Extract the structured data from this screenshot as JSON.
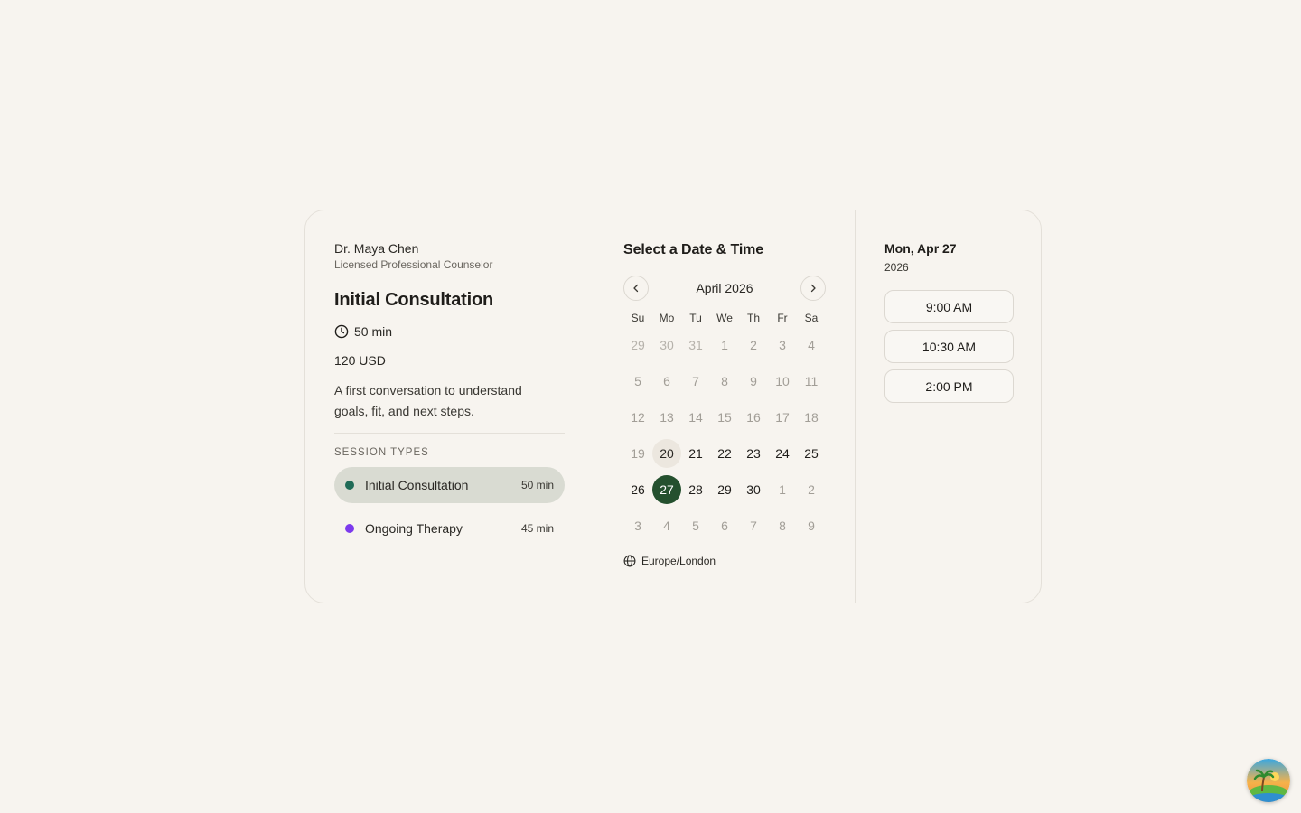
{
  "host": {
    "name": "Dr. Maya Chen",
    "title": "Licensed Professional Counselor"
  },
  "event": {
    "title": "Initial Consultation",
    "duration": "50 min",
    "price": "120 USD",
    "description": "A first conversation to understand goals, fit, and next steps."
  },
  "session_types": {
    "label": "SESSION TYPES",
    "items": [
      {
        "label": "Initial Consultation",
        "duration": "50 min",
        "color": "#1f6b57",
        "active": true
      },
      {
        "label": "Ongoing Therapy",
        "duration": "45 min",
        "color": "#7c3aed",
        "active": false
      }
    ]
  },
  "calendar": {
    "heading": "Select a Date & Time",
    "month_label": "April 2026",
    "weekdays": [
      "Su",
      "Mo",
      "Tu",
      "We",
      "Th",
      "Fr",
      "Sa"
    ],
    "days": [
      {
        "d": "29",
        "s": "muted"
      },
      {
        "d": "30",
        "s": "muted"
      },
      {
        "d": "31",
        "s": "muted"
      },
      {
        "d": "1",
        "s": "unavail"
      },
      {
        "d": "2",
        "s": "unavail"
      },
      {
        "d": "3",
        "s": "unavail"
      },
      {
        "d": "4",
        "s": "unavail"
      },
      {
        "d": "5",
        "s": "unavail"
      },
      {
        "d": "6",
        "s": "unavail"
      },
      {
        "d": "7",
        "s": "unavail"
      },
      {
        "d": "8",
        "s": "unavail"
      },
      {
        "d": "9",
        "s": "unavail"
      },
      {
        "d": "10",
        "s": "unavail"
      },
      {
        "d": "11",
        "s": "unavail"
      },
      {
        "d": "12",
        "s": "unavail"
      },
      {
        "d": "13",
        "s": "unavail"
      },
      {
        "d": "14",
        "s": "unavail"
      },
      {
        "d": "15",
        "s": "unavail"
      },
      {
        "d": "16",
        "s": "unavail"
      },
      {
        "d": "17",
        "s": "unavail"
      },
      {
        "d": "18",
        "s": "unavail"
      },
      {
        "d": "19",
        "s": "unavail"
      },
      {
        "d": "20",
        "s": "today"
      },
      {
        "d": "21",
        "s": "avail"
      },
      {
        "d": "22",
        "s": "avail"
      },
      {
        "d": "23",
        "s": "avail"
      },
      {
        "d": "24",
        "s": "avail"
      },
      {
        "d": "25",
        "s": "avail"
      },
      {
        "d": "26",
        "s": "avail"
      },
      {
        "d": "27",
        "s": "selected"
      },
      {
        "d": "28",
        "s": "avail"
      },
      {
        "d": "29",
        "s": "avail"
      },
      {
        "d": "30",
        "s": "avail"
      },
      {
        "d": "1",
        "s": "unavail"
      },
      {
        "d": "2",
        "s": "unavail"
      },
      {
        "d": "3",
        "s": "unavail"
      },
      {
        "d": "4",
        "s": "unavail"
      },
      {
        "d": "5",
        "s": "unavail"
      },
      {
        "d": "6",
        "s": "unavail"
      },
      {
        "d": "7",
        "s": "unavail"
      },
      {
        "d": "8",
        "s": "unavail"
      },
      {
        "d": "9",
        "s": "unavail"
      }
    ],
    "timezone": "Europe/London"
  },
  "selection": {
    "date": "Mon, Apr 27",
    "year": "2026",
    "slots": [
      "9:00 AM",
      "10:30 AM",
      "2:00 PM"
    ]
  },
  "colors": {
    "accent": "#24502e",
    "background": "#f7f4ef",
    "active_session_bg": "#d9dbd2"
  }
}
